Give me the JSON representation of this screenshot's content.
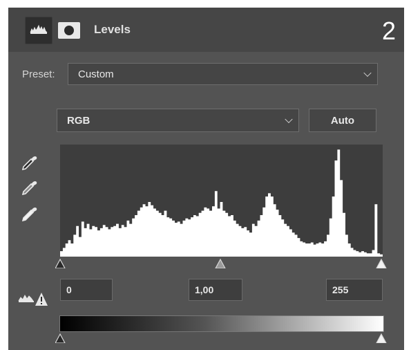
{
  "panel": {
    "title": "Levels",
    "step_number": "2",
    "icons": [
      "histogram-icon",
      "mask-icon"
    ]
  },
  "preset": {
    "label": "Preset:",
    "value": "Custom"
  },
  "channel": {
    "value": "RGB"
  },
  "auto_button": {
    "label": "Auto"
  },
  "eyedroppers": [
    "black-point-eyedropper-icon",
    "gray-point-eyedropper-icon",
    "white-point-eyedropper-icon"
  ],
  "input_levels": {
    "shadows": "0",
    "midtones": "1,00",
    "highlights": "255"
  },
  "output_levels": {
    "black": 0,
    "white": 255
  },
  "histogram": {
    "heights": [
      0.05,
      0.08,
      0.12,
      0.15,
      0.12,
      0.2,
      0.28,
      0.18,
      0.32,
      0.26,
      0.3,
      0.25,
      0.28,
      0.27,
      0.24,
      0.26,
      0.29,
      0.27,
      0.25,
      0.27,
      0.28,
      0.3,
      0.26,
      0.29,
      0.27,
      0.33,
      0.3,
      0.35,
      0.38,
      0.42,
      0.45,
      0.48,
      0.46,
      0.5,
      0.47,
      0.44,
      0.42,
      0.4,
      0.38,
      0.42,
      0.36,
      0.35,
      0.33,
      0.31,
      0.32,
      0.3,
      0.33,
      0.35,
      0.34,
      0.36,
      0.38,
      0.37,
      0.4,
      0.42,
      0.45,
      0.44,
      0.42,
      0.46,
      0.6,
      0.44,
      0.5,
      0.42,
      0.4,
      0.37,
      0.38,
      0.33,
      0.3,
      0.28,
      0.26,
      0.27,
      0.24,
      0.22,
      0.3,
      0.28,
      0.33,
      0.38,
      0.45,
      0.55,
      0.58,
      0.55,
      0.48,
      0.43,
      0.38,
      0.34,
      0.3,
      0.28,
      0.25,
      0.22,
      0.2,
      0.17,
      0.14,
      0.13,
      0.12,
      0.12,
      0.13,
      0.11,
      0.12,
      0.13,
      0.12,
      0.14,
      0.2,
      0.35,
      0.55,
      0.88,
      0.98,
      0.7,
      0.4,
      0.2,
      0.12,
      0.08,
      0.06,
      0.05,
      0.04,
      0.05,
      0.04,
      0.03,
      0.03,
      0.06,
      0.48,
      0.03,
      0.02
    ]
  },
  "colors": {
    "panel_bg": "#535353",
    "header_bg": "#464646",
    "histogram_bg": "#3d3d3d",
    "histogram_fill": "#ffffff"
  }
}
